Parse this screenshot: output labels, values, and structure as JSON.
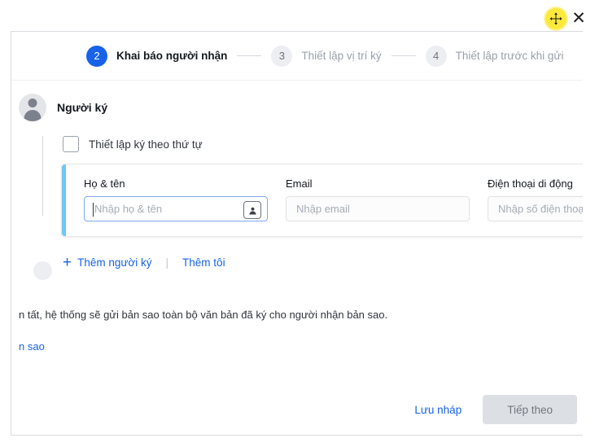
{
  "window": {
    "close_label": "✕",
    "move_cursor_icon": "move-cursor-icon"
  },
  "stepper": {
    "steps": [
      {
        "number": "2",
        "label": "Khai báo người nhận",
        "state": "active"
      },
      {
        "number": "3",
        "label": "Thiết lập vị trí ký",
        "state": "inactive"
      },
      {
        "number": "4",
        "label": "Thiết lập trước khi gửi",
        "state": "inactive"
      }
    ]
  },
  "signer_section": {
    "title": "Người ký",
    "order_checkbox_label": "Thiết lập ký theo thứ tự",
    "order_checkbox_checked": false
  },
  "recipient_form": {
    "fields": [
      {
        "label": "Họ & tên",
        "placeholder": "Nhập họ & tên",
        "value": "",
        "focused": true,
        "has_contact_picker": true
      },
      {
        "label": "Email",
        "placeholder": "Nhập email",
        "value": "",
        "focused": false,
        "has_contact_picker": false
      },
      {
        "label": "Điện thoại di động",
        "placeholder": "Nhập số điện thoại",
        "value": "",
        "focused": false,
        "has_contact_picker": false
      }
    ],
    "accent_color": "#6ec6f5"
  },
  "actions": {
    "add_signer_label": "Thêm người ký",
    "add_signer_icon": "plus-icon",
    "separator": "|",
    "add_me_label": "Thêm tôi"
  },
  "note": {
    "text": "n tất, hệ thống sẽ gửi bản sao toàn bộ văn bản đã ký cho người nhận bản sao.",
    "link_text": "n sao"
  },
  "footer": {
    "save_draft_label": "Lưu nháp",
    "next_label": "Tiếp theo"
  },
  "colors": {
    "accent_blue": "#1762e8",
    "step_inactive": "#eceef1",
    "card_accent": "#6ec6f5",
    "cursor_highlight": "#fbe93c",
    "next_button_bg": "#dcdfe4"
  }
}
